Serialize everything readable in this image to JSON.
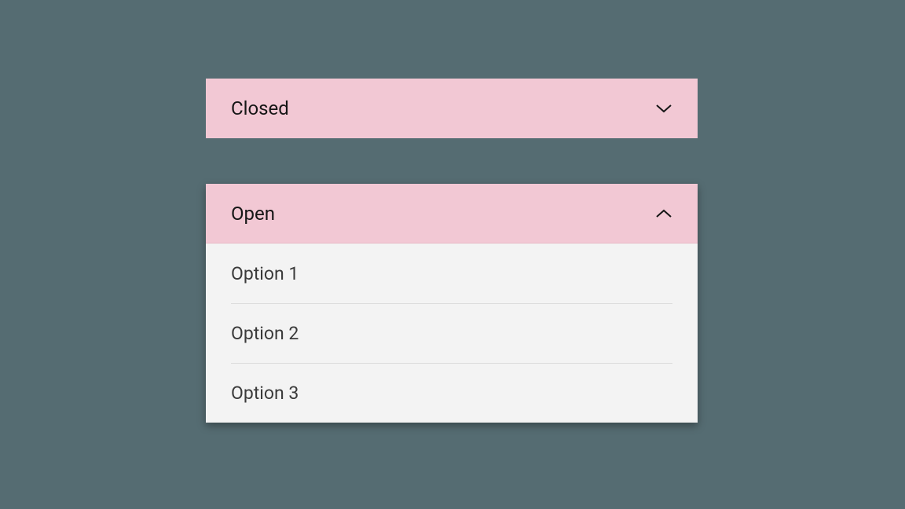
{
  "closed": {
    "label": "Closed"
  },
  "open": {
    "label": "Open",
    "options": {
      "0": "Option 1",
      "1": "Option 2",
      "2": "Option 3"
    }
  },
  "colors": {
    "header_bg": "#f2c8d4",
    "option_bg": "#f3f3f3",
    "page_bg": "#556c72"
  }
}
